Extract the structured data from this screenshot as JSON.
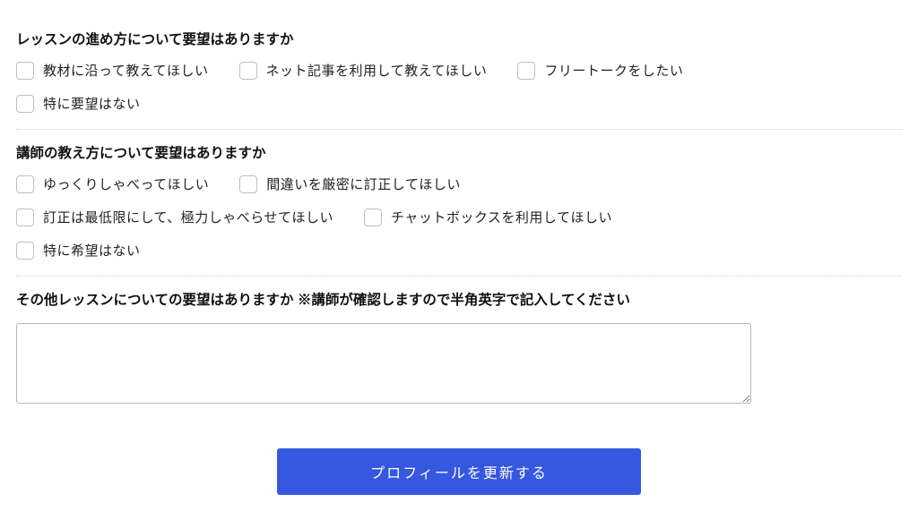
{
  "sections": {
    "lesson_flow": {
      "title": "レッスンの進め方について要望はありますか",
      "options": [
        "教材に沿って教えてほしい",
        "ネット記事を利用して教えてほしい",
        "フリートークをしたい",
        "特に要望はない"
      ]
    },
    "teaching_style": {
      "title": "講師の教え方について要望はありますか",
      "options": [
        "ゆっくりしゃべってほしい",
        "間違いを厳密に訂正してほしい",
        "訂正は最低限にして、極力しゃべらせてほしい",
        "チャットボックスを利用してほしい",
        "特に希望はない"
      ]
    },
    "other": {
      "title": "その他レッスンについての要望はありますか ※講師が確認しますので半角英字で記入してください",
      "value": ""
    }
  },
  "submit_label": "プロフィールを更新する"
}
